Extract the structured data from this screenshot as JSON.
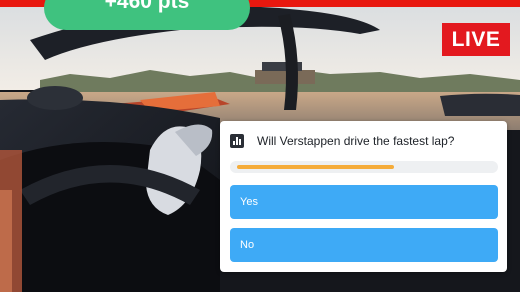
{
  "overlay": {
    "points_text": "+460 pts",
    "live_label": "LIVE"
  },
  "poll": {
    "icon": "bar-chart-icon",
    "question": "Will Verstappen drive the fastest lap?",
    "progress": 0.62,
    "options": [
      {
        "label": "Yes"
      },
      {
        "label": "No"
      }
    ]
  },
  "colors": {
    "accent_red": "#e3191f",
    "points_green": "#3fc27f",
    "option_blue": "#3eaaf6",
    "progress_orange": "#f5ac3a"
  }
}
